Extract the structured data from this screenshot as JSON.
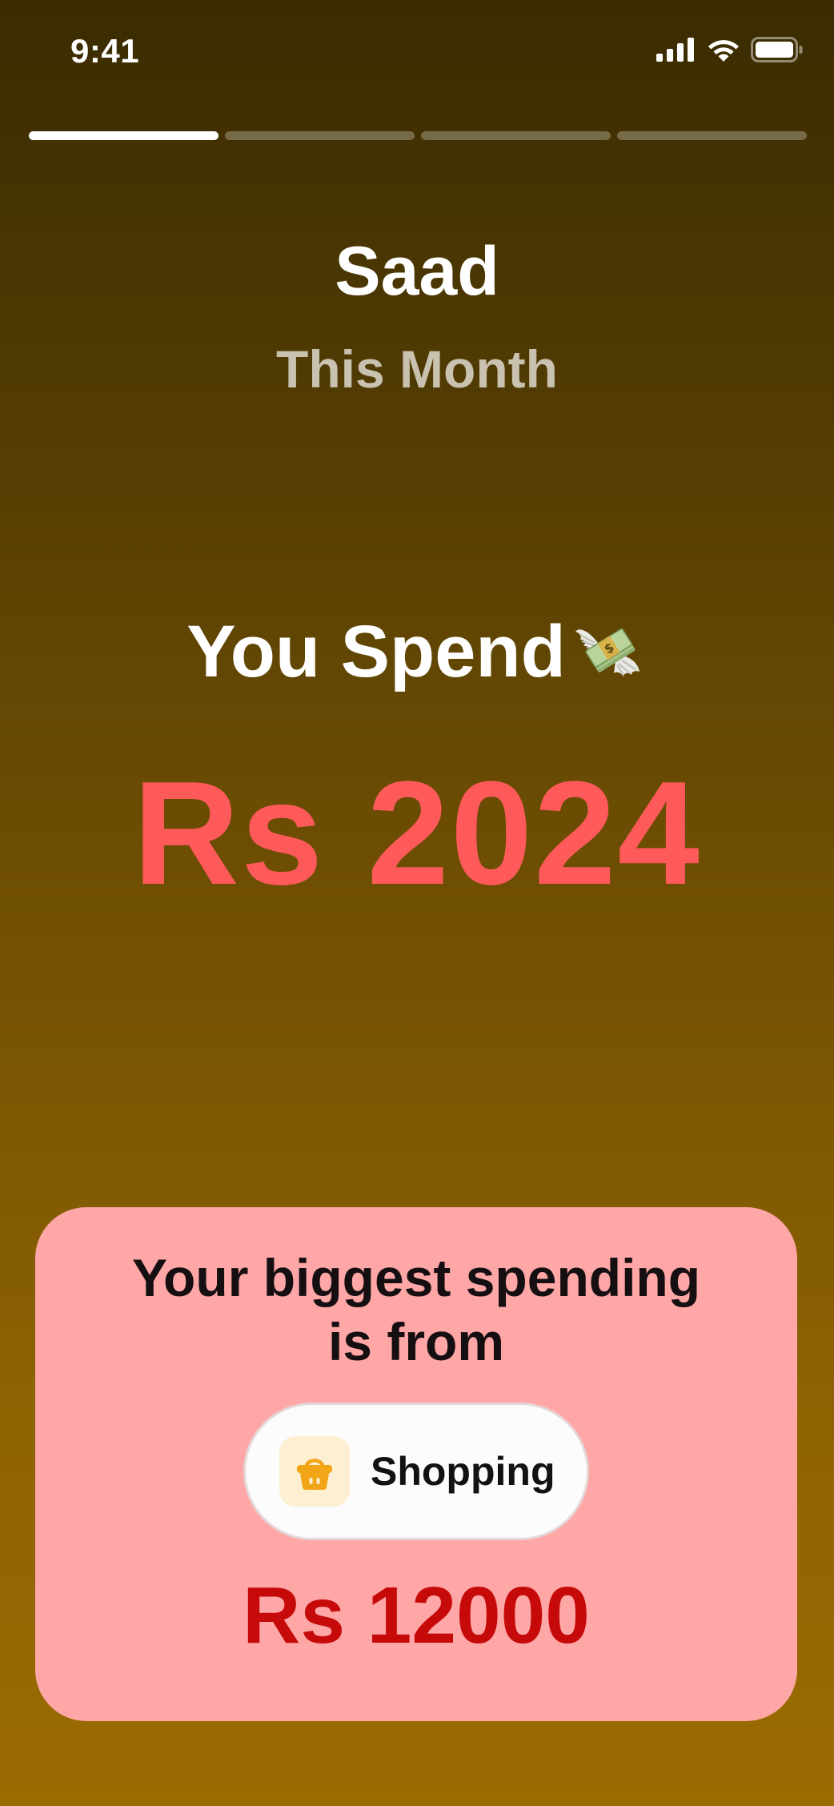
{
  "status_bar": {
    "time": "9:41"
  },
  "progress": {
    "total_segments": 4,
    "active_segment": 1
  },
  "header": {
    "name": "Saad",
    "period": "This Month"
  },
  "summary": {
    "heading": "You Spend",
    "heading_emoji": "money-with-wings-icon",
    "amount": "Rs 2024"
  },
  "biggest_spending": {
    "title_line1": "Your biggest spending",
    "title_line2": "is from",
    "category": {
      "label": "Shopping",
      "icon": "shopping-basket-icon"
    },
    "amount": "Rs 12000"
  },
  "colors": {
    "background_top": "#3a2b02",
    "background_bottom": "#9a6b01",
    "total_amount": "#ff5a5a",
    "card_background": "#ffa6a6",
    "card_amount": "#c60a0a",
    "category_icon_background": "#fcefd2",
    "category_icon": "#f2a516"
  }
}
